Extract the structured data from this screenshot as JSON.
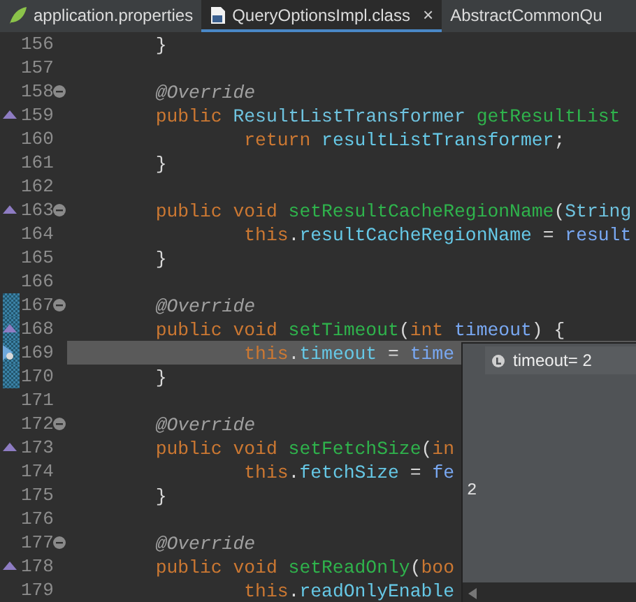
{
  "tabs": [
    {
      "label": "application.properties",
      "selected": false,
      "closable": false
    },
    {
      "label": "QueryOptionsImpl.class",
      "selected": true,
      "closable": true,
      "close": "×"
    },
    {
      "label": "AbstractCommonQu",
      "selected": false,
      "closable": false
    }
  ],
  "editor": {
    "lines": [
      {
        "number": "156",
        "fold": false,
        "override": false,
        "debug": false,
        "current": false,
        "marked": false,
        "tokens": [
          {
            "kind": "plain",
            "text": "\t}"
          }
        ]
      },
      {
        "number": "157",
        "fold": false,
        "override": false,
        "debug": false,
        "current": false,
        "marked": false
      },
      {
        "number": "158",
        "fold": true,
        "override": false,
        "debug": false,
        "current": false,
        "marked": false,
        "tokens": [
          {
            "kind": "annotation",
            "text": "\t@Override"
          }
        ]
      },
      {
        "number": "159",
        "fold": false,
        "override": true,
        "debug": false,
        "current": false,
        "marked": false,
        "tokens": [
          {
            "kind": "keyword",
            "text": "\tpublic "
          },
          {
            "kind": "type",
            "text": "ResultListTransformer "
          },
          {
            "kind": "method",
            "text": "getResultList"
          }
        ]
      },
      {
        "number": "160",
        "fold": false,
        "override": false,
        "debug": false,
        "current": false,
        "marked": false,
        "tokens": [
          {
            "kind": "keyword",
            "text": "\t\treturn "
          },
          {
            "kind": "field",
            "text": "resultListTransformer"
          },
          {
            "kind": "plain",
            "text": ";"
          }
        ]
      },
      {
        "number": "161",
        "fold": false,
        "override": false,
        "debug": false,
        "current": false,
        "marked": false,
        "tokens": [
          {
            "kind": "plain",
            "text": "\t}"
          }
        ]
      },
      {
        "number": "162",
        "fold": false,
        "override": false,
        "debug": false,
        "current": false,
        "marked": false
      },
      {
        "number": "163",
        "fold": true,
        "override": true,
        "debug": false,
        "current": false,
        "marked": false,
        "tokens": [
          {
            "kind": "keyword",
            "text": "\tpublic void "
          },
          {
            "kind": "method",
            "text": "setResultCacheRegionName"
          },
          {
            "kind": "plain",
            "text": "("
          },
          {
            "kind": "type",
            "text": "String"
          }
        ]
      },
      {
        "number": "164",
        "fold": false,
        "override": false,
        "debug": false,
        "current": false,
        "marked": false,
        "tokens": [
          {
            "kind": "keyword",
            "text": "\t\tthis"
          },
          {
            "kind": "plain",
            "text": "."
          },
          {
            "kind": "field",
            "text": "resultCacheRegionName"
          },
          {
            "kind": "plain",
            "text": " = "
          },
          {
            "kind": "param",
            "text": "result"
          }
        ]
      },
      {
        "number": "165",
        "fold": false,
        "override": false,
        "debug": false,
        "current": false,
        "marked": false,
        "tokens": [
          {
            "kind": "plain",
            "text": "\t}"
          }
        ]
      },
      {
        "number": "166",
        "fold": false,
        "override": false,
        "debug": false,
        "current": false,
        "marked": false
      },
      {
        "number": "167",
        "fold": true,
        "override": false,
        "debug": false,
        "current": false,
        "marked": true,
        "tokens": [
          {
            "kind": "annotation",
            "text": "\t@Override"
          }
        ]
      },
      {
        "number": "168",
        "fold": false,
        "override": true,
        "debug": false,
        "current": false,
        "marked": true,
        "tokens": [
          {
            "kind": "keyword",
            "text": "\tpublic void "
          },
          {
            "kind": "method",
            "text": "setTimeout"
          },
          {
            "kind": "plain",
            "text": "("
          },
          {
            "kind": "keyword",
            "text": "int "
          },
          {
            "kind": "param",
            "text": "timeout"
          },
          {
            "kind": "plain",
            "text": ") {"
          }
        ]
      },
      {
        "number": "169",
        "fold": false,
        "override": false,
        "debug": true,
        "current": true,
        "marked": true,
        "tokens": [
          {
            "kind": "keyword",
            "text": "\t\tthis"
          },
          {
            "kind": "plain",
            "text": "."
          },
          {
            "kind": "field",
            "text": "timeout"
          },
          {
            "kind": "plain",
            "text": " = "
          },
          {
            "kind": "param",
            "text": "time"
          }
        ]
      },
      {
        "number": "170",
        "fold": false,
        "override": false,
        "debug": false,
        "current": false,
        "marked": true,
        "tokens": [
          {
            "kind": "plain",
            "text": "\t}"
          }
        ]
      },
      {
        "number": "171",
        "fold": false,
        "override": false,
        "debug": false,
        "current": false,
        "marked": false
      },
      {
        "number": "172",
        "fold": true,
        "override": false,
        "debug": false,
        "current": false,
        "marked": false,
        "tokens": [
          {
            "kind": "annotation",
            "text": "\t@Override"
          }
        ]
      },
      {
        "number": "173",
        "fold": false,
        "override": true,
        "debug": false,
        "current": false,
        "marked": false,
        "tokens": [
          {
            "kind": "keyword",
            "text": "\tpublic void "
          },
          {
            "kind": "method",
            "text": "setFetchSize"
          },
          {
            "kind": "plain",
            "text": "("
          },
          {
            "kind": "keyword",
            "text": "in"
          }
        ]
      },
      {
        "number": "174",
        "fold": false,
        "override": false,
        "debug": false,
        "current": false,
        "marked": false,
        "tokens": [
          {
            "kind": "keyword",
            "text": "\t\tthis"
          },
          {
            "kind": "plain",
            "text": "."
          },
          {
            "kind": "field",
            "text": "fetchSize"
          },
          {
            "kind": "plain",
            "text": " = "
          },
          {
            "kind": "param",
            "text": "fe"
          }
        ]
      },
      {
        "number": "175",
        "fold": false,
        "override": false,
        "debug": false,
        "current": false,
        "marked": false,
        "tokens": [
          {
            "kind": "plain",
            "text": "\t}"
          }
        ]
      },
      {
        "number": "176",
        "fold": false,
        "override": false,
        "debug": false,
        "current": false,
        "marked": false
      },
      {
        "number": "177",
        "fold": true,
        "override": false,
        "debug": false,
        "current": false,
        "marked": false,
        "tokens": [
          {
            "kind": "annotation",
            "text": "\t@Override"
          }
        ]
      },
      {
        "number": "178",
        "fold": false,
        "override": true,
        "debug": false,
        "current": false,
        "marked": false,
        "tokens": [
          {
            "kind": "keyword",
            "text": "\tpublic void "
          },
          {
            "kind": "method",
            "text": "setReadOnly"
          },
          {
            "kind": "plain",
            "text": "("
          },
          {
            "kind": "keyword",
            "text": "boo"
          }
        ]
      },
      {
        "number": "179",
        "fold": false,
        "override": false,
        "debug": false,
        "current": false,
        "marked": false,
        "tokens": [
          {
            "kind": "keyword",
            "text": "\t\tthis"
          },
          {
            "kind": "plain",
            "text": "."
          },
          {
            "kind": "field",
            "text": "readOnlyEnable"
          }
        ]
      }
    ]
  },
  "hover": {
    "variable": "timeout= 2",
    "detail": "2"
  }
}
